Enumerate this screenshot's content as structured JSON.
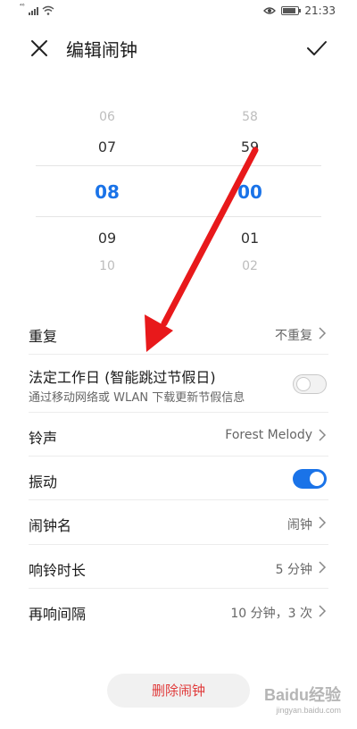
{
  "status_bar": {
    "network_label": "⁴⁶",
    "time": "21:33"
  },
  "header": {
    "title": "编辑闹钟"
  },
  "picker": {
    "hours": [
      "06",
      "07",
      "08",
      "09",
      "10"
    ],
    "minutes": [
      "58",
      "59",
      "00",
      "01",
      "02"
    ]
  },
  "settings": {
    "repeat": {
      "label": "重复",
      "value": "不重复"
    },
    "workday": {
      "label": "法定工作日 (智能跳过节假日)",
      "sub": "通过移动网络或 WLAN 下载更新节假信息",
      "enabled": false
    },
    "ringtone": {
      "label": "铃声",
      "value": "Forest Melody"
    },
    "vibrate": {
      "label": "振动",
      "enabled": true
    },
    "alarm_name": {
      "label": "闹钟名",
      "value": "闹钟"
    },
    "ring_duration": {
      "label": "响铃时长",
      "value": "5 分钟"
    },
    "snooze": {
      "label": "再响间隔",
      "value": "10 分钟，3 次"
    }
  },
  "delete_button": {
    "label": "删除闹钟"
  },
  "watermark": {
    "text": "Baidu经验",
    "url": "jingyan.baidu.com"
  },
  "colors": {
    "accent": "#1a73e8",
    "danger": "#e03a3a",
    "arrow": "#e8191b"
  }
}
